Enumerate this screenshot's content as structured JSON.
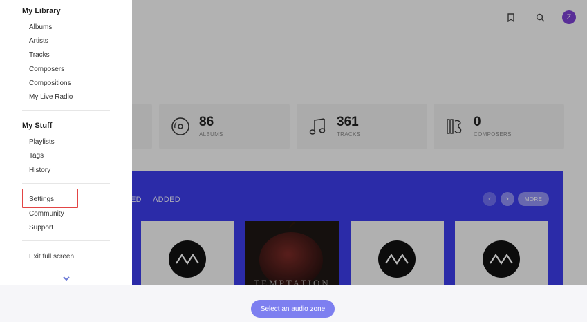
{
  "topbar": {
    "icons": [
      "bookmark-icon",
      "search-icon"
    ],
    "avatar_letter": "Z",
    "avatar_color": "#7b3fd0"
  },
  "stats": [
    {
      "value": "86",
      "label": "ALBUMS",
      "icon": "album-disc-icon"
    },
    {
      "value": "361",
      "label": "TRACKS",
      "icon": "music-note-icon"
    },
    {
      "value": "0",
      "label": "COMPOSERS",
      "icon": "composer-icon"
    }
  ],
  "panel": {
    "tabs": [
      "ED",
      "ADDED"
    ],
    "more_label": "MORE",
    "prev_label": "‹",
    "next_label": "›",
    "cards": [
      {
        "type": "logo",
        "icon": "waveform-logo-icon"
      },
      {
        "type": "cover",
        "title": "TEMPTATION"
      },
      {
        "type": "logo",
        "icon": "waveform-logo-icon"
      },
      {
        "type": "logo",
        "icon": "waveform-logo-icon"
      }
    ],
    "accent": "#3b3be6"
  },
  "sidebar": {
    "my_library": {
      "title": "My Library",
      "items": [
        "Albums",
        "Artists",
        "Tracks",
        "Composers",
        "Compositions",
        "My Live Radio"
      ]
    },
    "my_stuff": {
      "title": "My Stuff",
      "items": [
        "Playlists",
        "Tags",
        "History"
      ]
    },
    "misc": {
      "items": [
        "Settings",
        "Community",
        "Support"
      ]
    },
    "exit_label": "Exit full screen"
  },
  "bottom": {
    "zone_button": "Select an audio zone",
    "zone_color": "#7d7ff0"
  }
}
